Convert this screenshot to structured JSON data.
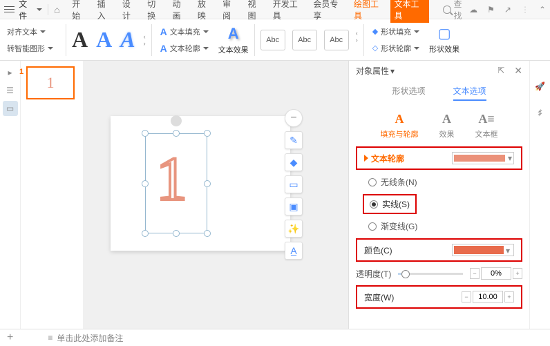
{
  "topbar": {
    "file_label": "文件",
    "tabs": [
      "开始",
      "插入",
      "设计",
      "切换",
      "动画",
      "放映",
      "审阅",
      "视图",
      "开发工具",
      "会员专享",
      "绘图工具",
      "文本工具"
    ],
    "search_label": "查找"
  },
  "ribbon": {
    "align_text": "对齐文本",
    "smart_graphic": "转智能图形",
    "text_fill": "文本填充",
    "text_outline": "文本轮廓",
    "text_effects": "文本效果",
    "abc": "Abc",
    "shape_fill": "形状填充",
    "shape_outline": "形状轮廓",
    "shape_effects": "形状效果"
  },
  "thumbs": {
    "num": "1",
    "glyph": "1"
  },
  "canvas": {
    "glyph": "1"
  },
  "props": {
    "title": "对象属性",
    "tab_shape": "形状选项",
    "tab_text": "文本选项",
    "sub_fill": "填充与轮廓",
    "sub_fx": "效果",
    "sub_box": "文本框",
    "section_outline": "文本轮廓",
    "opt_none": "无线条(N)",
    "opt_solid": "实线(S)",
    "opt_gradient": "渐变线(G)",
    "color_label": "颜色(C)",
    "opacity_label": "透明度(T)",
    "opacity_val": "0%",
    "width_label": "宽度(W)",
    "width_val": "10.00"
  },
  "footer": {
    "notes": "单击此处添加备注"
  }
}
